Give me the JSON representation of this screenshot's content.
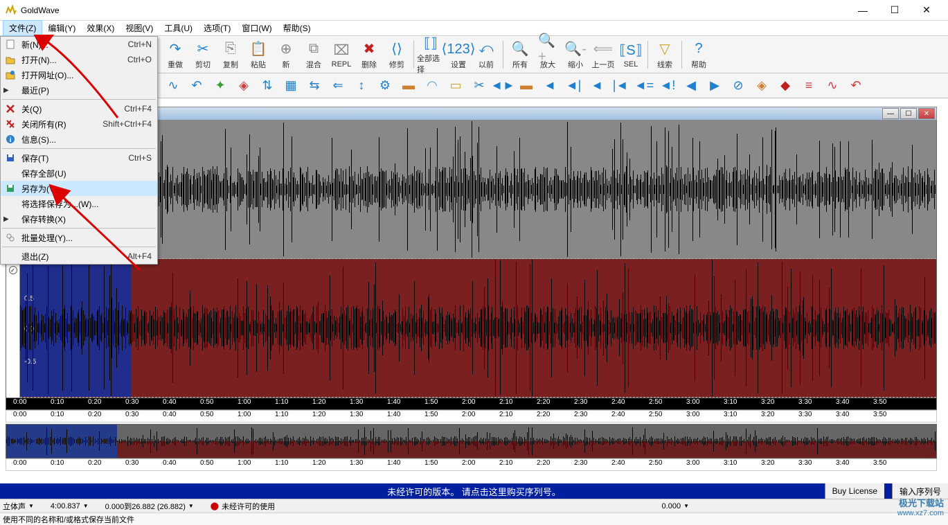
{
  "app": {
    "title": "GoldWave"
  },
  "menubar": {
    "items": [
      {
        "label": "文件(Z)"
      },
      {
        "label": "编辑(Y)"
      },
      {
        "label": "效果(X)"
      },
      {
        "label": "视图(V)"
      },
      {
        "label": "工具(U)"
      },
      {
        "label": "选项(T)"
      },
      {
        "label": "窗口(W)"
      },
      {
        "label": "帮助(S)"
      }
    ]
  },
  "dropdown": {
    "items": [
      {
        "icon": "new",
        "label": "新(N)...",
        "shortcut": "Ctrl+N"
      },
      {
        "icon": "open",
        "label": "打开(N)...",
        "shortcut": "Ctrl+O"
      },
      {
        "icon": "url",
        "label": "打开网址(O)..."
      },
      {
        "icon": "",
        "label": "最近(P)",
        "submenu": true
      },
      {
        "sep": true
      },
      {
        "icon": "close",
        "label": "关(Q)",
        "shortcut": "Ctrl+F4"
      },
      {
        "icon": "closeall",
        "label": "关闭所有(R)",
        "shortcut": "Shift+Ctrl+F4"
      },
      {
        "icon": "info",
        "label": "信息(S)..."
      },
      {
        "sep": true
      },
      {
        "icon": "save",
        "label": "保存(T)",
        "shortcut": "Ctrl+S"
      },
      {
        "icon": "",
        "label": "保存全部(U)"
      },
      {
        "icon": "saveas",
        "label": "另存为(V)...",
        "highlight": true
      },
      {
        "icon": "",
        "label": "将选择保存为...(W)...",
        "hidden_arrow": true
      },
      {
        "icon": "",
        "label": "保存转换(X)",
        "submenu": true
      },
      {
        "sep": true
      },
      {
        "icon": "batch",
        "label": "批量处理(Y)..."
      },
      {
        "sep": true
      },
      {
        "icon": "",
        "label": "退出(Z)",
        "shortcut": "Alt+F4"
      }
    ]
  },
  "toolbar": {
    "items": [
      {
        "name": "redo",
        "label": "重做",
        "color": "#2080d0"
      },
      {
        "name": "cut",
        "label": "剪切",
        "color": "#2080d0"
      },
      {
        "name": "copy",
        "label": "复制",
        "color": "#888"
      },
      {
        "name": "paste",
        "label": "粘贴",
        "color": "#888"
      },
      {
        "name": "new",
        "label": "新",
        "color": "#888"
      },
      {
        "name": "mix",
        "label": "混合",
        "color": "#888"
      },
      {
        "name": "repl",
        "label": "REPL",
        "color": "#888"
      },
      {
        "name": "delete",
        "label": "删除",
        "color": "#c02020"
      },
      {
        "name": "trim",
        "label": "修剪",
        "color": "#2080d0"
      },
      {
        "sep": true
      },
      {
        "name": "selall",
        "label": "全部选择",
        "color": "#2080d0"
      },
      {
        "name": "settings",
        "label": "设置",
        "color": "#2080d0"
      },
      {
        "name": "prev",
        "label": "以前",
        "color": "#2080d0"
      },
      {
        "sep": true
      },
      {
        "name": "all",
        "label": "所有",
        "color": "#aaa"
      },
      {
        "name": "zoomin",
        "label": "放大",
        "color": "#aaa"
      },
      {
        "name": "zoomout",
        "label": "缩小",
        "color": "#aaa"
      },
      {
        "name": "prevpage",
        "label": "上一页",
        "color": "#aaa"
      },
      {
        "name": "sel",
        "label": "SEL",
        "color": "#2080d0"
      },
      {
        "sep": true
      },
      {
        "name": "cue",
        "label": "线索",
        "color": "#d0a020"
      },
      {
        "sep": true
      },
      {
        "name": "help",
        "label": "帮助",
        "color": "#2080d0"
      }
    ]
  },
  "timeline": {
    "ticks": [
      "0:00",
      "0:10",
      "0:20",
      "0:30",
      "0:40",
      "0:50",
      "1:00",
      "1:10",
      "1:20",
      "1:30",
      "1:40",
      "1:50",
      "2:00",
      "2:10",
      "2:20",
      "2:30",
      "2:40",
      "2:50",
      "3:00",
      "3:10",
      "3:20",
      "3:30",
      "3:40",
      "3:50"
    ]
  },
  "wave_axis": {
    "labels": [
      "0.5",
      "0.0",
      "-0.5"
    ]
  },
  "banner": {
    "text": "未经许可的版本。  请点击这里购买序列号。",
    "buy": "Buy License",
    "serial": "输入序列号"
  },
  "statusbar": {
    "stereo": "立体声",
    "duration": "4:00.837",
    "range": "0.000到26.882 (26.882)",
    "modified": "未经许可的使用",
    "zero": "0.000"
  },
  "tooltip": {
    "text": "使用不同的名称和/或格式保存当前文件"
  },
  "watermark": {
    "brand": "极光下载站",
    "url": "www.xz7.com"
  }
}
